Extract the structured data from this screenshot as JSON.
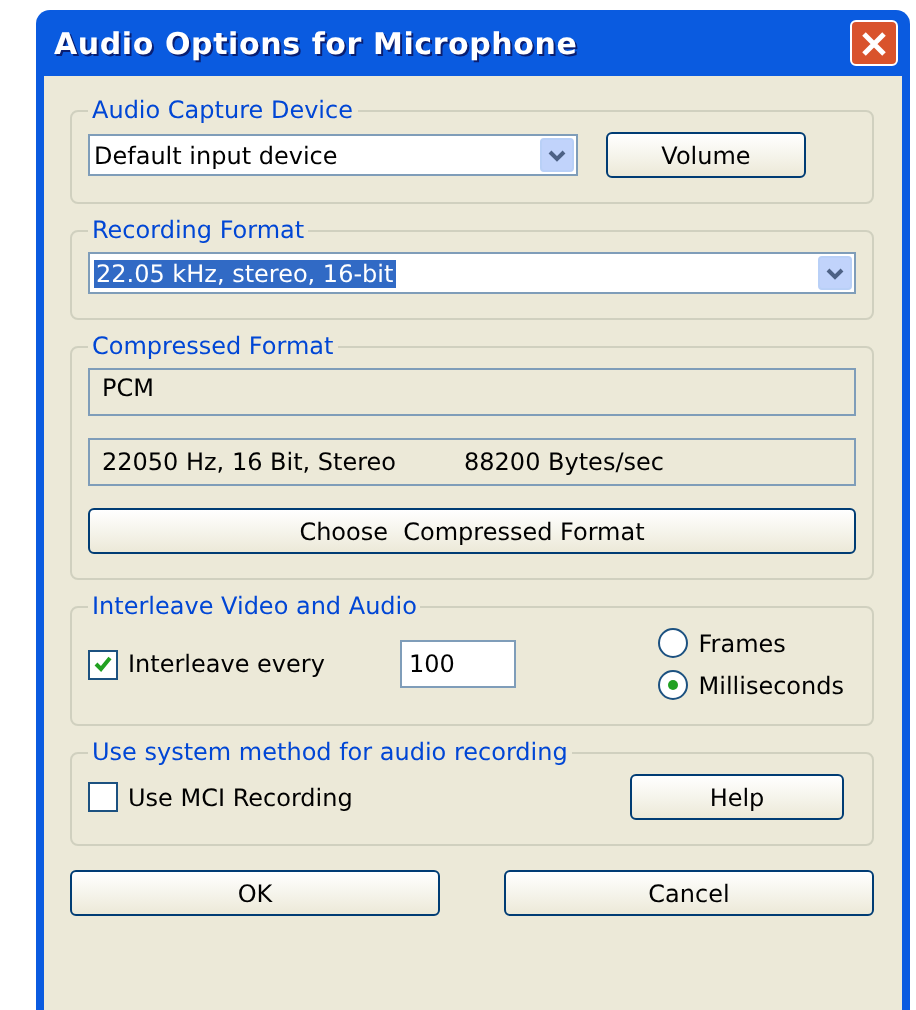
{
  "window": {
    "title": "Audio Options for Microphone"
  },
  "capture_device": {
    "legend": "Audio Capture Device",
    "device": "Default input device",
    "volume_button": "Volume"
  },
  "recording_format": {
    "legend": "Recording Format",
    "format": "22.05 kHz, stereo, 16-bit",
    "selected": true
  },
  "compressed_format": {
    "legend": "Compressed Format",
    "name": "PCM",
    "details": "22050 Hz, 16 Bit, Stereo",
    "rate": "88200 Bytes/sec",
    "choose_button": "Choose  Compressed Format"
  },
  "interleave": {
    "legend": "Interleave Video and Audio",
    "checkbox": {
      "label": "Interleave every",
      "checked": true
    },
    "value": "100",
    "units": [
      {
        "label": "Frames",
        "selected": false
      },
      {
        "label": "Milliseconds",
        "selected": true
      }
    ]
  },
  "system_method": {
    "legend": "Use system method for audio recording",
    "checkbox": {
      "label": "Use MCI Recording",
      "checked": false
    },
    "help_button": "Help"
  },
  "buttons": [
    "OK",
    "Cancel"
  ]
}
